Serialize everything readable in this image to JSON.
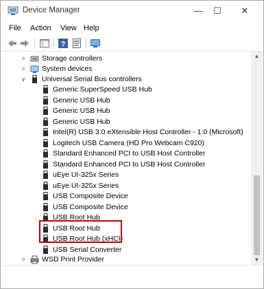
{
  "window": {
    "title": "Device Manager",
    "minimize": "—",
    "maximize": "☐",
    "close": "✕"
  },
  "menu": {
    "file": "File",
    "action": "Action",
    "view": "View",
    "help": "Help"
  },
  "toolbar": [
    "back-icon",
    "forward-icon",
    "show-hide-console-tree-icon",
    "help-icon",
    "properties-icon",
    "scan-monitor-icon"
  ],
  "tree": {
    "storage_controllers": "Storage controllers",
    "system_devices": "System devices",
    "usb_controllers": "Universal Serial Bus controllers",
    "usb_items": [
      "Generic SuperSpeed USB Hub",
      "Generic USB Hub",
      "Generic USB Hub",
      "Generic USB Hub",
      "Intel(R) USB 3.0 eXtensible Host Controller - 1.0 (Microsoft)",
      "Logitech USB Camera (HD Pro Webcam C920)",
      "Standard Enhanced PCI to USB Host Controller",
      "Standard Enhanced PCI to USB Host Controller",
      "uEye UI-325x Series",
      "uEye UI-325x Series",
      "USB Composite Device",
      "USB Composite Device",
      "USB Root Hub",
      "USB Root Hub",
      "USB Root Hub (xHCI)",
      "USB Serial Converter"
    ],
    "wsd_print_provider": "WSD Print Provider"
  },
  "colors": {
    "highlight_border": "#c00000",
    "scrollbar_thumb": "#c2c2c2"
  }
}
